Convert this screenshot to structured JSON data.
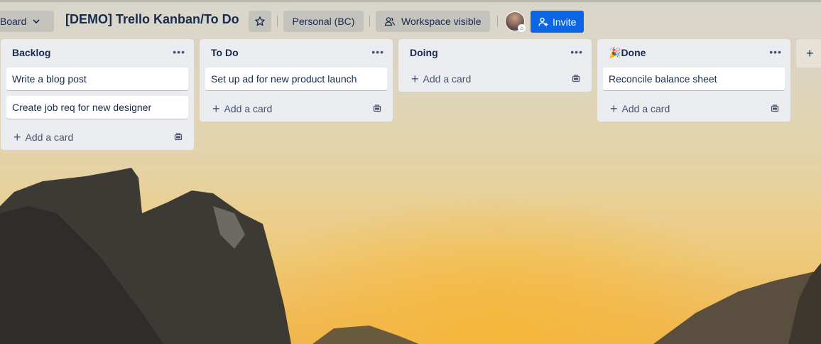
{
  "header": {
    "board_switcher_label": "Board",
    "board_title": "[DEMO] Trello Kanban/To Do",
    "workspace_label": "Personal (BC)",
    "visibility_label": "Workspace visible",
    "invite_label": "Invite"
  },
  "lists": [
    {
      "title": "Backlog",
      "cards": [
        "Write a blog post",
        "Create job req for new designer"
      ],
      "add_label": "Add a card"
    },
    {
      "title": "To Do",
      "cards": [
        "Set up ad for new product launch"
      ],
      "add_label": "Add a card"
    },
    {
      "title": "Doing",
      "cards": [],
      "add_label": "Add a card"
    },
    {
      "title": "Done",
      "emoji": "🎉",
      "cards": [
        "Reconcile balance sheet"
      ],
      "add_label": "Add a card"
    }
  ],
  "colors": {
    "invite_button": "#0c66e4",
    "list_background": "#ebecf0",
    "text": "#172b4d"
  },
  "icons": [
    "chevron-down-icon",
    "star-icon",
    "people-icon",
    "add-person-icon",
    "ellipsis-icon",
    "plus-icon",
    "template-icon"
  ]
}
